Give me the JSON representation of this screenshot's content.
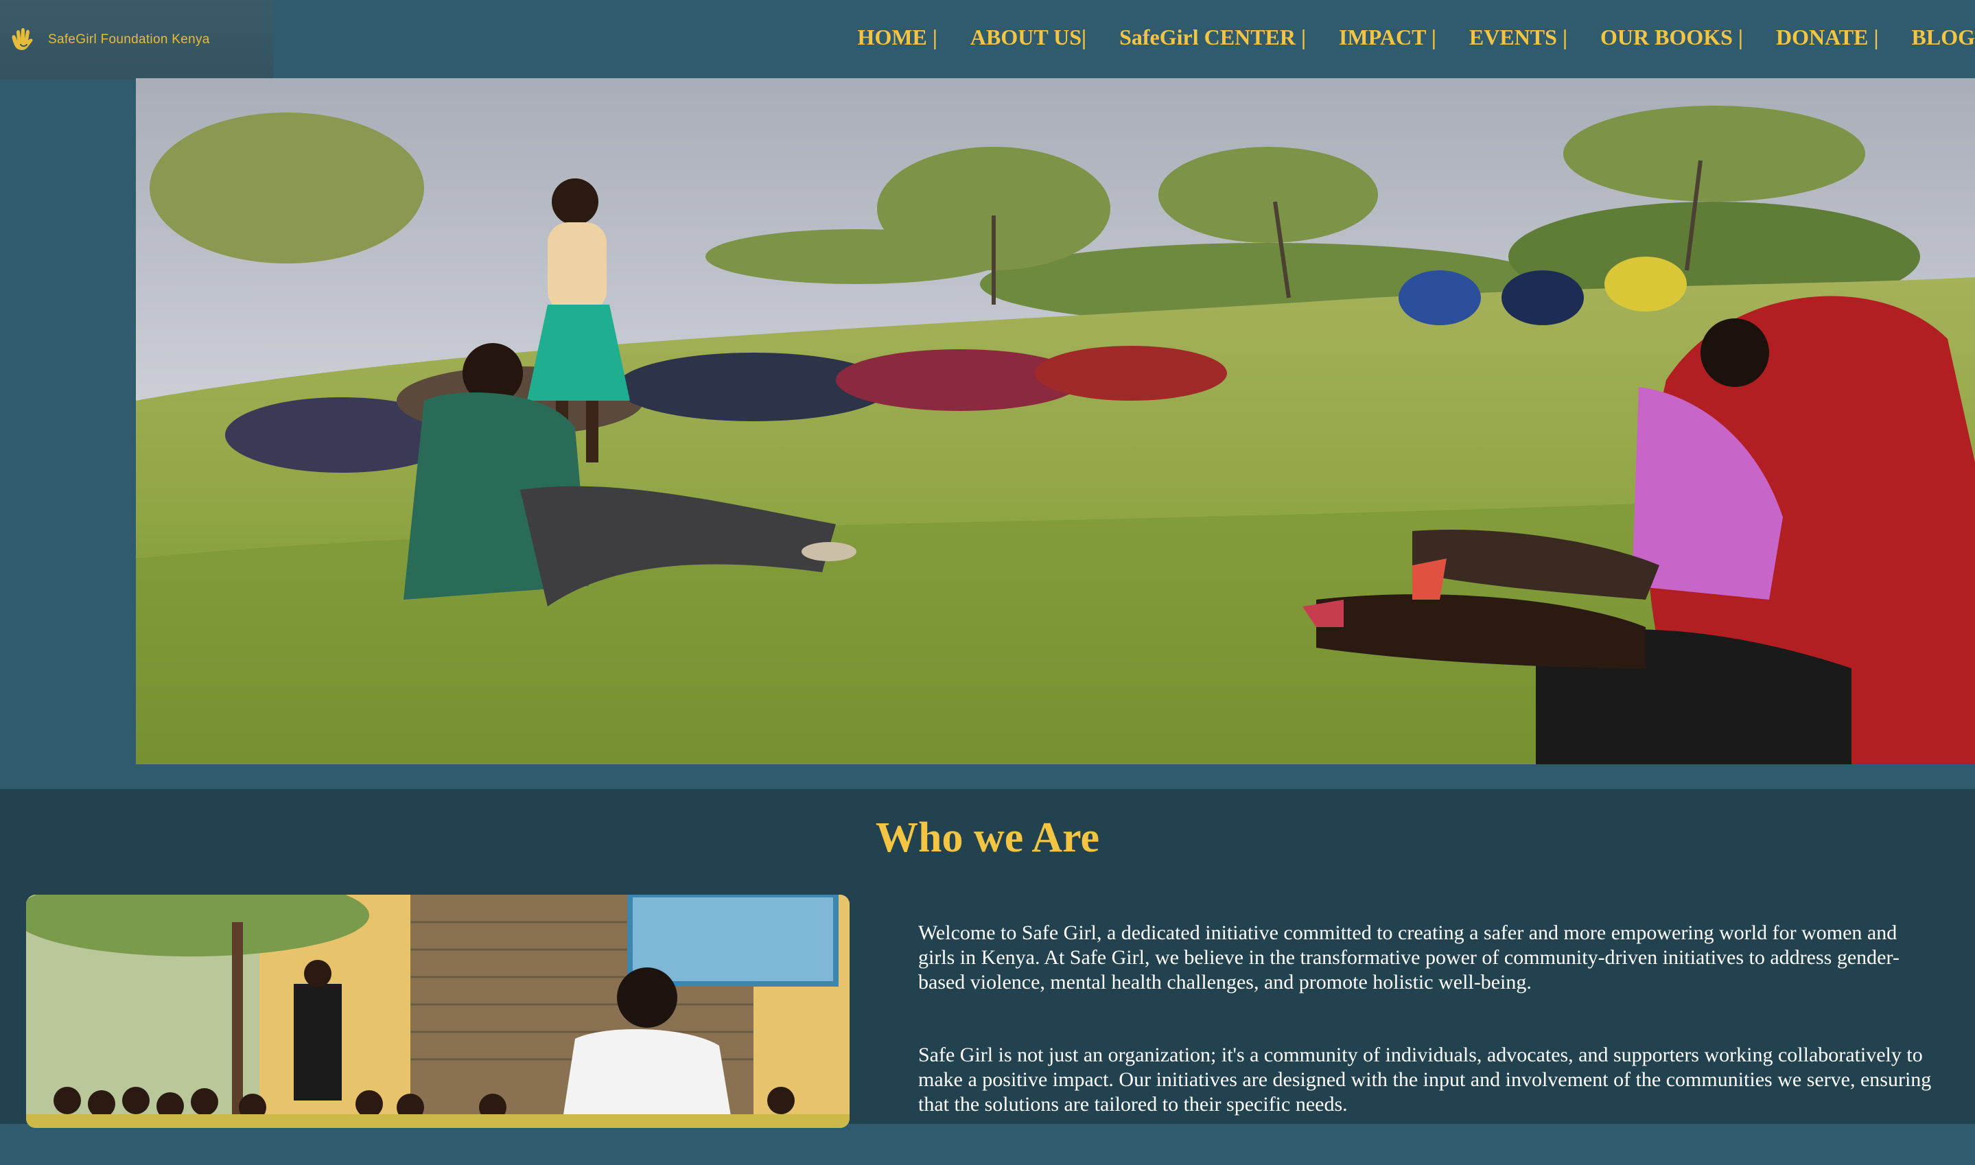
{
  "brand": {
    "name": "SafeGirl Foundation Kenya",
    "logo_icon": "hand-icon"
  },
  "nav": {
    "items": [
      {
        "label": "HOME |"
      },
      {
        "label": "ABOUT US|"
      },
      {
        "label": "SafeGirl CENTER |"
      },
      {
        "label": "IMPACT |"
      },
      {
        "label": "EVENTS |"
      },
      {
        "label": "OUR BOOKS |"
      },
      {
        "label": "DONATE |"
      },
      {
        "label": "BLOG"
      }
    ]
  },
  "who": {
    "title": "Who we Are",
    "paragraphs": [
      "Welcome to Safe Girl, a dedicated initiative committed to creating a safer and more empowering world for women and girls in Kenya. At Safe Girl, we believe in the transformative power of community-driven initiatives to address gender-based violence, mental health challenges, and promote holistic well-being.",
      "Safe Girl is not just an organization; it's a community of individuals, advocates, and supporters working collaboratively to make a positive impact. Our initiatives are designed with the input and involvement of the communities we serve, ensuring that the solutions are tailored to their specific needs."
    ]
  },
  "colors": {
    "header_bg": "#2f5b6d",
    "section_bg": "#22424f",
    "accent": "#f4c542"
  }
}
